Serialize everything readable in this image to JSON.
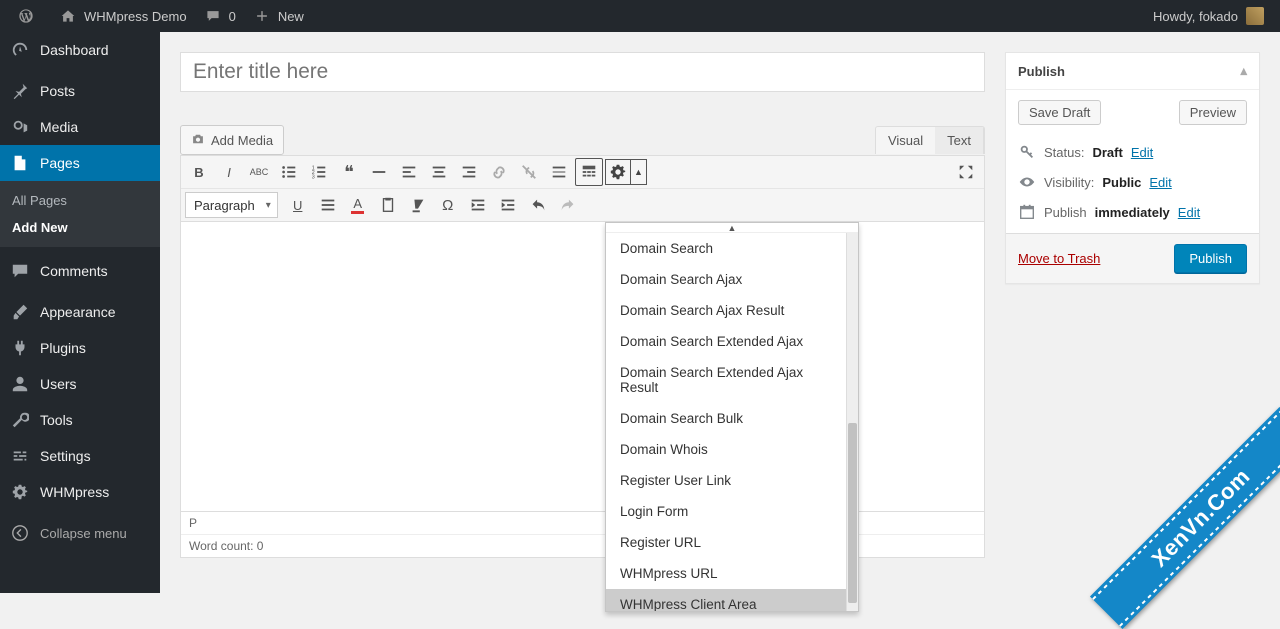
{
  "adminbar": {
    "site": "WHMpress Demo",
    "comments": "0",
    "new": "New",
    "greeting": "Howdy, fokado"
  },
  "sidebar": {
    "items": [
      {
        "label": "Dashboard"
      },
      {
        "label": "Posts"
      },
      {
        "label": "Media"
      },
      {
        "label": "Pages"
      },
      {
        "label": "Comments"
      },
      {
        "label": "Appearance"
      },
      {
        "label": "Plugins"
      },
      {
        "label": "Users"
      },
      {
        "label": "Tools"
      },
      {
        "label": "Settings"
      },
      {
        "label": "WHMpress"
      }
    ],
    "submenu": {
      "all": "All Pages",
      "add": "Add New"
    },
    "collapse": "Collapse menu"
  },
  "editor": {
    "title_placeholder": "Enter title here",
    "add_media": "Add Media",
    "tabs": {
      "visual": "Visual",
      "text": "Text"
    },
    "format_sel": "Paragraph",
    "status_path": "P",
    "word_count": "Word count: 0",
    "dropdown_items": [
      "Domain Search",
      "Domain Search Ajax",
      "Domain Search Ajax Result",
      "Domain Search Extended Ajax",
      "Domain Search Extended Ajax Result",
      "Domain Search Bulk",
      "Domain Whois",
      "Register User Link",
      "Login Form",
      "Register URL",
      "WHMpress URL",
      "WHMpress Client Area"
    ]
  },
  "publish": {
    "title": "Publish",
    "save_draft": "Save Draft",
    "preview": "Preview",
    "status_label": "Status:",
    "status_value": "Draft",
    "visibility_label": "Visibility:",
    "visibility_value": "Public",
    "publish_label": "Publish",
    "publish_value": "immediately",
    "edit": "Edit",
    "trash": "Move to Trash",
    "submit": "Publish"
  },
  "watermark": "XenVn.Com"
}
